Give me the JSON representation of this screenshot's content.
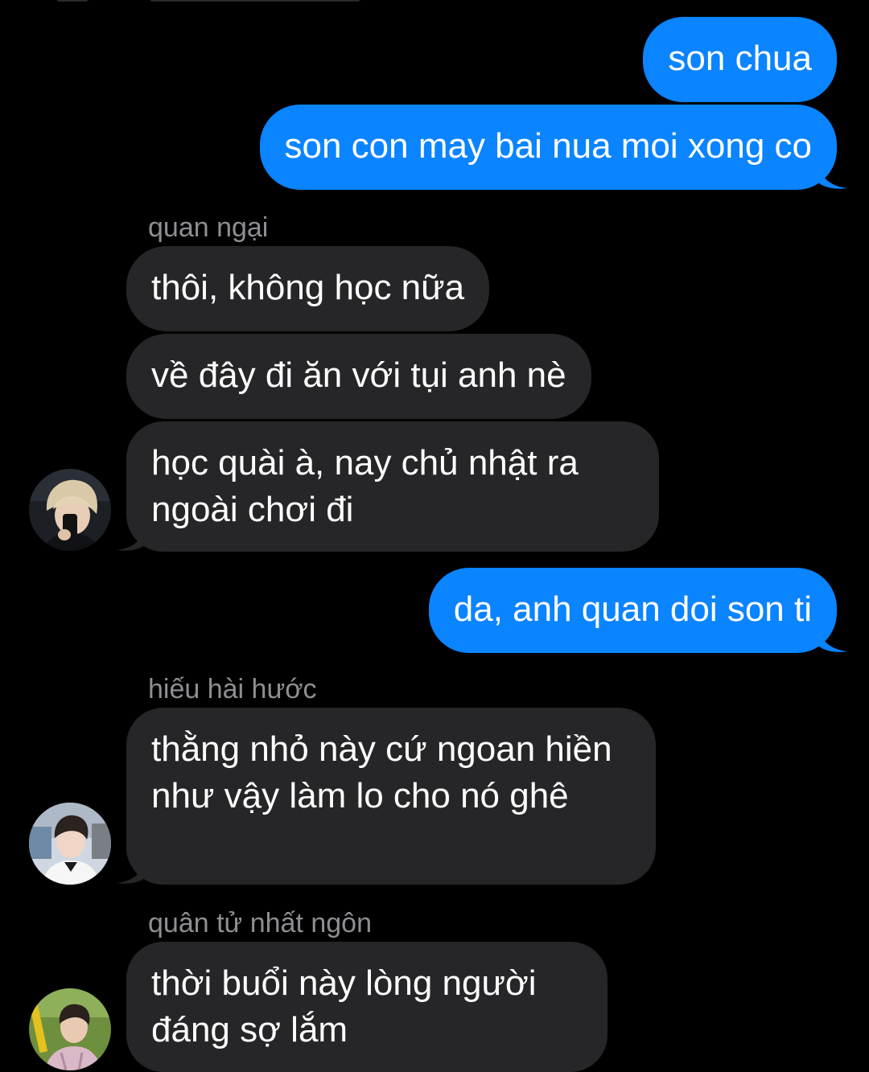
{
  "conversation": {
    "messages": [
      {
        "side": "out",
        "text": "son chua"
      },
      {
        "side": "out",
        "text": "son con may bai nua moi xong co"
      },
      {
        "side": "in",
        "sender": "quan ngại",
        "text": "thôi, không học nữa"
      },
      {
        "side": "in",
        "text": "về đây đi ăn với tụi anh nè"
      },
      {
        "side": "in",
        "text": "học quài à, nay chủ nhật ra ngoài chơi đi",
        "avatar": "avatar-blonde-selfie"
      },
      {
        "side": "out",
        "text": "da, anh quan doi son ti"
      },
      {
        "side": "in",
        "sender": "hiếu hài hước",
        "text": "thằng nhỏ này cứ ngoan hiền như vậy làm lo cho nó ghê",
        "avatar": "avatar-dark-hair-white-shirt"
      },
      {
        "side": "in",
        "sender": "quân tử nhất ngôn",
        "text": "thời buổi này lòng người đáng sợ lắm",
        "avatar": "avatar-outdoor-field"
      }
    ]
  },
  "colors": {
    "background": "#000000",
    "outgoing_bubble": "#0a84ff",
    "incoming_bubble": "#262628",
    "sender_name": "#8e8e93",
    "text": "#ffffff"
  }
}
